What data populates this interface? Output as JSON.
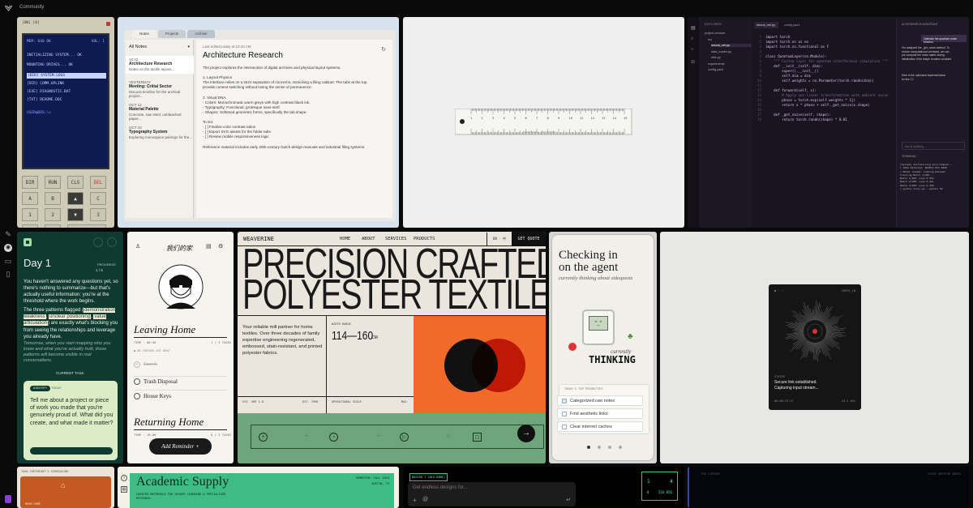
{
  "topbar": {
    "title": "Community"
  },
  "terminal": {
    "badge": "[ON] [0]",
    "vol": "VOL: 1",
    "header": "MEM: 640 OK",
    "lines": [
      "INITIALIZING SYSTEM... OK",
      "MOUNTING DRIVES... OK"
    ],
    "files": [
      "[DIR] SYSTEM.LOGS",
      "[DIR] COMM.UPLINK",
      "[EXE] DIAGNOSTIC.BAT",
      "[TXT] README.DOC"
    ],
    "prompt": "USER@DOS:\\>",
    "keys": [
      "DIR",
      "RUN",
      "CLS",
      "DEL",
      "A",
      "B",
      "▲",
      "C",
      "1",
      "2",
      "▼",
      "3",
      ".",
      "DEL",
      "ENTER ↵"
    ]
  },
  "notes": {
    "tabs": [
      "Notes",
      "Projects",
      "Archive"
    ],
    "filter": "All Notes",
    "items": [
      {
        "date": "10:42",
        "title": "Architecture Research",
        "desc": "Notes on the tactile layout..."
      },
      {
        "date": "YESTERDAY",
        "title": "Meeting: Critial Sector",
        "desc": "Discuss timeline for the archival project..."
      },
      {
        "date": "OCT 12",
        "title": "Material Palette",
        "desc": "Concrete, raw steel, unbleached paper..."
      },
      {
        "date": "OCT 10",
        "title": "Typography System",
        "desc": "Exploring monospace pairings for the..."
      }
    ],
    "edited": "Last edited today at 10:42 AM",
    "title": "Architecture Research",
    "body": [
      "The project explores the intersection of digital archives and physical layout systems.",
      "",
      "1. Layout Physics",
      "The interface relies on a strict separation of concerns, mimicking a filing cabinet. The tabs at the top",
      "provide context switching without losing the sense of permanence.",
      "",
      "2. Visual DNA",
      "- Colors: Monochromatic warm greys with high contrast black ink.",
      "- Typography: Functional, grotesque sans-serif.",
      "- Shapes: Softened geometric forms, specifically the tab shape.",
      "",
      "To Do:",
      "- [ ] Finalize color contrast ratios",
      "- [ ] Export SVG assets for the folder tabs",
      "- [ ] Review mobile responsiveness logic",
      "",
      "Reference material includes early 20th-century Dutch design manuals and industrial filing systems."
    ]
  },
  "ruler": {
    "label": "PROFESSIONAL INSTRUMENTS",
    "numbers": [
      "1",
      "2",
      "3",
      "4",
      "5",
      "6",
      "7",
      "8",
      "9",
      "10",
      "11",
      "12",
      "13",
      "14",
      "15"
    ]
  },
  "ide": {
    "explorer": "EXPLORER",
    "tabs": [
      "neural_net.py",
      "config.yaml"
    ],
    "files": [
      "project-venture",
      "src",
      "neural_net.py",
      "data_loader.py",
      "utils.py",
      "experiments",
      "config.yaml"
    ],
    "code": [
      "import torch",
      "import torch.nn as nn",
      "import torch.nn.functional as F",
      "",
      "class QuantumLayer(nn.Module):",
      "    \"\"\" Custom layer for quantum interference simulation \"\"\"",
      "    def __init__(self, dim):",
      "        super().__init__()",
      "        self.dim = dim",
      "        self.weights = nn.Parameter(torch.randn(dim))",
      "",
      "    def forward(self, x):",
      "        # Apply non-linear transformation with ambient noise",
      "        phase = torch.exp(self.weights * 1j)",
      "        return x * phase + self._get_noise(x.shape)",
      "",
      "    def _get_noise(self, shape):",
      "        return torch.randn(shape) * 0.01"
    ],
    "assistant_title": "AI RESEARCH ASSISTANT",
    "user_msg": "Optimize the quantum noise function.",
    "bot_msg": "I've analyzed the _get_noise method. To reduce computational overhead, we can pre-compute the noise matrix during initialization if the shape remains constant.",
    "bot_msg2": "Here is the optimized implementation for line 17:",
    "ask_placeholder": "Ask AI anything...",
    "terminal_title": "TERMINAL",
    "terminal_lines": [
      "[System] Initializing environment...",
      "> CUDA Detected: NVIDIA RTX 4090",
      "> Model loaded: Loading Dataset",
      "Training Batch 1/100...",
      "Batch 1/100: Loss 0.452",
      "Batch 2/100: Loss 0.421",
      "Batch 3/100: Loss 0.398",
      "> python train.py --epochs 50"
    ]
  },
  "dayone": {
    "title": "Day 1",
    "progress_label": "PROGRESS",
    "progress": "1 / 5",
    "p1": "You haven't answered any questions yet, so there's nothing to summarize—but that's actually useful information: you're at the threshold where the work begins.",
    "p2a": "The three patterns flagged (",
    "hl1": "demonstration weakness",
    "hl2": "unclear positioning",
    "hl3": "value articulation",
    "p2b": ") are exactly what's blocking you from seeing the relationships and leverage you already have.",
    "p3": "Tomorrow, when you start mapping who you know and what you've actually built, those patterns will become visible in real conversations.",
    "task_label": "CURRENT TASK",
    "chip1": "IDENTIFY",
    "chip2": "TODAY",
    "task": "Tell me about a project or piece of work you made that you're genuinely proud of. What did you create, and what made it matter?"
  },
  "home": {
    "brand": "我们的家",
    "section1": "Leaving Home",
    "time1": "TIME · 08:00",
    "count1": "1 / 3 TASKS",
    "checked": "● 88 CHECKED OUT BEAS",
    "done": "Sumoh",
    "tasks": [
      "Trash Disposal",
      "House Keys"
    ],
    "section2": "Returning Home",
    "time2": "TIME · 18:00",
    "count2": "0 / 2 TASKS",
    "add_button": "Add Reminder  +"
  },
  "weave": {
    "brand": "WEAVERINE",
    "nav": [
      "HOME",
      "ABOUT",
      "SERVICES",
      "PRODUCTS"
    ],
    "lang": "EN · 中",
    "cta": "GET QUOTE",
    "headline1": "PRECISION CRAFTED",
    "headline2": "POLYESTER TEXTILES",
    "intro": "Your reliable mill partner for home textiles. Over three decades of family expertise engineering regenerated, embossed, stain-resistant, and printed polyester fabrics.",
    "width_label": "WIDTH RANGE",
    "width_value": "114—160",
    "width_unit": "CM",
    "sys": "SYS. VER 1.0",
    "est": "EST. 1990",
    "scale": "OPERATIONAL SCALE",
    "max": "MAX"
  },
  "agent": {
    "title1": "Checking in",
    "title2": "on the agent",
    "subtitle": "currently thinking about sidequests",
    "currently": "currently",
    "thinking": "THINKING",
    "prio_label": "TODAY'S TOP PRIORITIES",
    "items": [
      "Categorized raw notes",
      "Find aesthetic links",
      "Clear internet caches"
    ]
  },
  "uplink": {
    "top_left": "● · ··",
    "top_right": "CHECK_LN",
    "status_label": "STATUS",
    "msg1": "Secure link established.",
    "msg2": "Capturing input stream...",
    "time": "00:00:23:17",
    "meta": "44.1 kHz"
  },
  "scrap": {
    "header": "TASK FORTNIGHT'S SCHEDULING",
    "icon_label": "MOON HOME"
  },
  "academic": {
    "title": "Academic Supply",
    "semester": "SEMESTER: FALL 2024",
    "location": "AUSTIN, TX",
    "tagline": "CURATED MATERIALS FOR HIGHER LEARNING & SPECIALIZED RESEARCH."
  },
  "prompt": {
    "badge": "BROTOR 7 (BIO·DOME)",
    "placeholder": "Get endless designs for..."
  },
  "mini": {
    "a": "1",
    "b": "4",
    "c": "0",
    "d": "516 856"
  },
  "library": {
    "left": "◦ THE LIBRARY",
    "right": "CLOSE ARCHIVE INDEX"
  }
}
